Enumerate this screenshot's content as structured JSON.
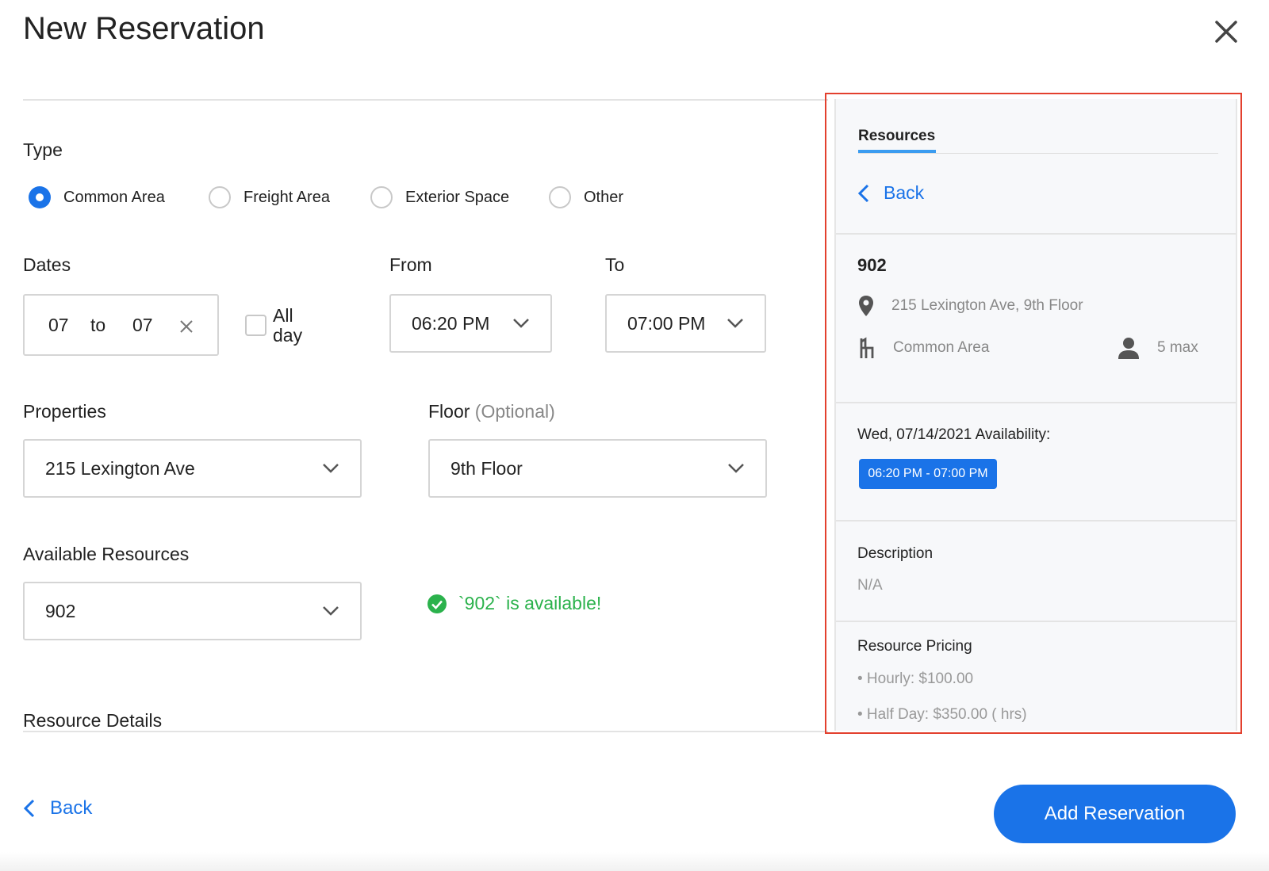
{
  "header": {
    "title": "New Reservation"
  },
  "type": {
    "label": "Type",
    "options": [
      {
        "label": "Common Area",
        "selected": true
      },
      {
        "label": "Freight Area",
        "selected": false
      },
      {
        "label": "Exterior Space",
        "selected": false
      },
      {
        "label": "Other",
        "selected": false
      }
    ]
  },
  "dates": {
    "label": "Dates",
    "start": "07",
    "separator": "to",
    "end": "07",
    "all_day_label": "All day",
    "all_day_checked": false
  },
  "from": {
    "label": "From",
    "value": "06:20 PM"
  },
  "to": {
    "label": "To",
    "value": "07:00 PM"
  },
  "properties": {
    "label": "Properties",
    "value": "215 Lexington Ave"
  },
  "floor": {
    "label": "Floor",
    "optional_label": "(Optional)",
    "value": "9th Floor"
  },
  "available_resources": {
    "label": "Available Resources",
    "value": "902",
    "status_message": "`902` is available!"
  },
  "resource_details": {
    "label": "Resource Details"
  },
  "footer": {
    "back_label": "Back",
    "submit_label": "Add Reservation"
  },
  "panel": {
    "tab_label": "Resources",
    "back_label": "Back",
    "resource": {
      "name": "902",
      "address": "215 Lexington Ave, 9th Floor",
      "type": "Common Area",
      "capacity": "5 max"
    },
    "availability": {
      "title": "Wed, 07/14/2021 Availability:",
      "slot": "06:20 PM - 07:00 PM"
    },
    "description": {
      "title": "Description",
      "value": "N/A"
    },
    "pricing": {
      "title": "Resource Pricing",
      "items": [
        "• Hourly: $100.00",
        "• Half Day: $350.00 ( hrs)"
      ]
    }
  },
  "colors": {
    "accent": "#1a73e8",
    "success": "#2bb24c",
    "highlight_outline": "#e3402e",
    "tab_underline": "#3b9cf0"
  }
}
